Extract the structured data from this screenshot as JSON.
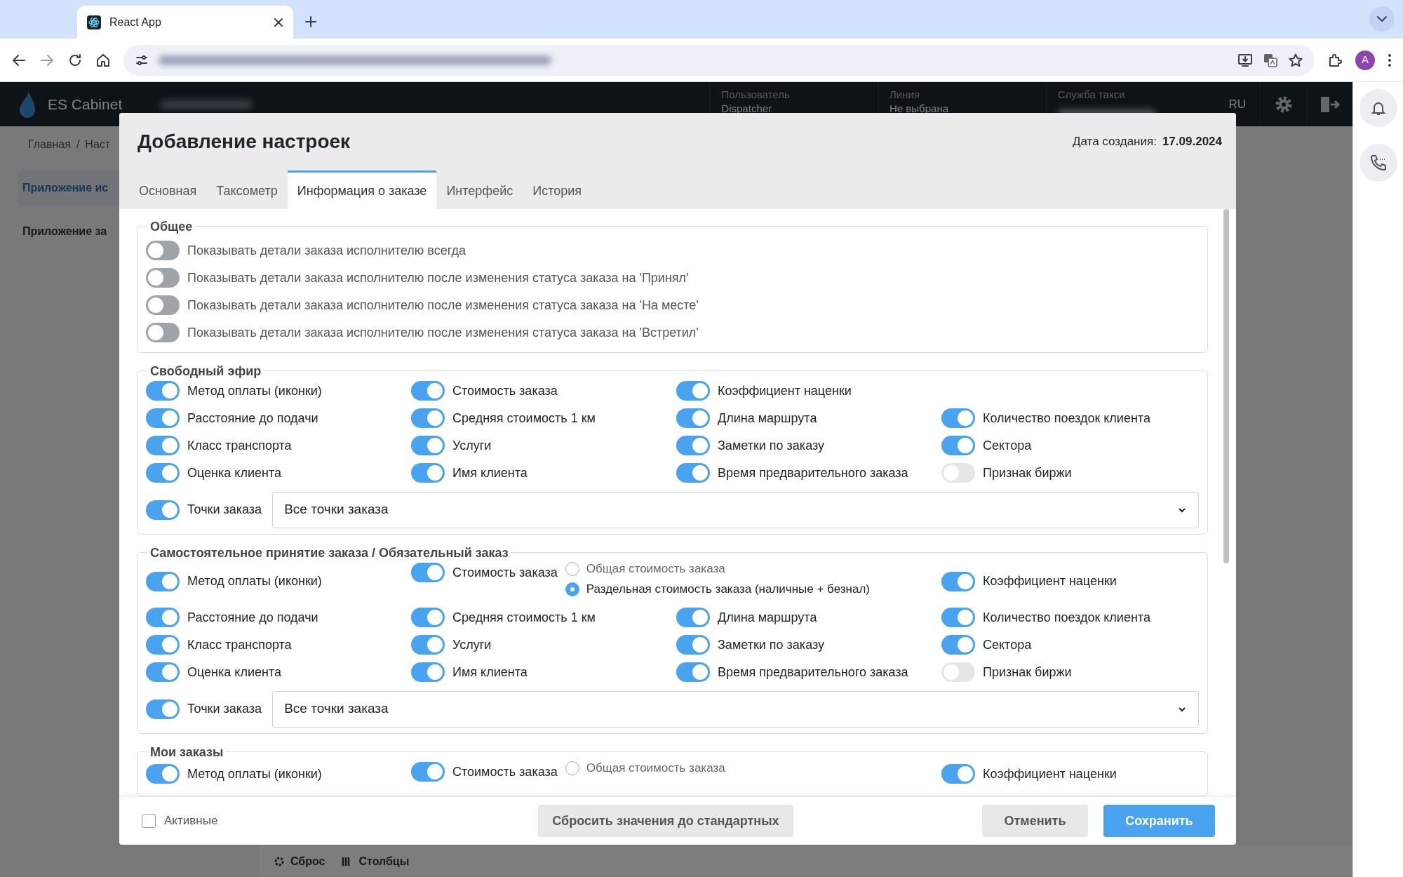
{
  "browser": {
    "tab_title": "React App",
    "avatar_letter": "A"
  },
  "app_header": {
    "brand": "ES Cabinet",
    "fields": [
      {
        "label": "Пользователь",
        "value": "Dispatcher"
      },
      {
        "label": "Линия",
        "value": "Не выбрана"
      },
      {
        "label": "Служба такси"
      }
    ],
    "language": "RU"
  },
  "page": {
    "breadcrumb": [
      "Главная",
      "Наст"
    ],
    "breadcrumb_separator": "/",
    "sidebar": [
      {
        "label": "Приложение ис",
        "selected": true
      },
      {
        "label": "Приложение за",
        "selected": false
      }
    ],
    "toolbar": [
      "Сброс",
      "Столбцы"
    ]
  },
  "modal": {
    "title": "Добавление настроек",
    "created_label": "Дата создания:",
    "created_date": "17.09.2024",
    "tabs": [
      {
        "label": "Основная",
        "selected": false
      },
      {
        "label": "Таксометр",
        "selected": false
      },
      {
        "label": "Информация о заказе",
        "selected": true
      },
      {
        "label": "Интерфейс",
        "selected": false
      },
      {
        "label": "История",
        "selected": false
      }
    ],
    "sections": [
      {
        "title": "Общее",
        "kind": "list",
        "items": [
          {
            "kind": "toggle",
            "label": "Показывать детали заказа исполнителю всегда",
            "on": false,
            "disabled": false
          },
          {
            "kind": "toggle",
            "label": "Показывать детали заказа исполнителю после изменения статуса заказа на 'Принял'",
            "on": false,
            "disabled": false
          },
          {
            "kind": "toggle",
            "label": "Показывать детали заказа исполнителю после изменения статуса заказа на 'На месте'",
            "on": false,
            "disabled": false
          },
          {
            "kind": "toggle",
            "label": "Показывать детали заказа исполнителю после изменения статуса заказа на 'Встретил'",
            "on": false,
            "disabled": false
          }
        ]
      },
      {
        "title": "Свободный эфир",
        "kind": "grid",
        "rows": [
          [
            {
              "kind": "toggle",
              "label": "Метод оплаты (иконки)",
              "on": true,
              "disabled": false
            },
            {
              "kind": "toggle",
              "label": "Стоимость заказа",
              "on": true,
              "disabled": false
            },
            {
              "kind": "toggle",
              "label": "Коэффициент наценки",
              "on": true,
              "disabled": false
            }
          ],
          [
            {
              "kind": "toggle",
              "label": "Расстояние до подачи",
              "on": true,
              "disabled": false
            },
            {
              "kind": "toggle",
              "label": "Средняя стоимость 1 км",
              "on": true,
              "disabled": false
            },
            {
              "kind": "toggle",
              "label": "Длина маршрута",
              "on": true,
              "disabled": false
            },
            {
              "kind": "toggle",
              "label": "Количество поездок клиента",
              "on": true,
              "disabled": false
            }
          ],
          [
            {
              "kind": "toggle",
              "label": "Класс транспорта",
              "on": true,
              "disabled": false
            },
            {
              "kind": "toggle",
              "label": "Услуги",
              "on": true,
              "disabled": false
            },
            {
              "kind": "toggle",
              "label": "Заметки по заказу",
              "on": true,
              "disabled": false
            },
            {
              "kind": "toggle",
              "label": "Сектора",
              "on": true,
              "disabled": false
            }
          ],
          [
            {
              "kind": "toggle",
              "label": "Оценка клиента",
              "on": true,
              "disabled": false
            },
            {
              "kind": "toggle",
              "label": "Имя клиента",
              "on": true,
              "disabled": false
            },
            {
              "kind": "toggle",
              "label": "Время предварительного заказа",
              "on": true,
              "disabled": false
            },
            {
              "kind": "toggle",
              "label": "Признак биржи",
              "on": false,
              "disabled": true
            }
          ]
        ],
        "points": {
          "label": "Точки заказа",
          "on": true,
          "value": "Все точки заказа"
        }
      },
      {
        "title": "Самостоятельное принятие заказа / Обязательный заказ",
        "kind": "grid",
        "rows": [
          [
            {
              "kind": "toggle",
              "label": "Метод оплаты (иконки)",
              "on": true,
              "disabled": false
            },
            {
              "kind": "toggle-radio",
              "label": "Стоимость заказа",
              "on": true,
              "disabled": false,
              "options": [
                {
                  "label": "Общая стоимость заказа",
                  "selected": false
                },
                {
                  "label": "Раздельная стоимость заказа (наличные + безнал)",
                  "selected": true
                }
              ]
            },
            "",
            {
              "kind": "toggle",
              "label": "Коэффициент наценки",
              "on": true,
              "disabled": false
            }
          ],
          [
            {
              "kind": "toggle",
              "label": "Расстояние до подачи",
              "on": true,
              "disabled": false
            },
            {
              "kind": "toggle",
              "label": "Средняя стоимость 1 км",
              "on": true,
              "disabled": false
            },
            {
              "kind": "toggle",
              "label": "Длина маршрута",
              "on": true,
              "disabled": false
            },
            {
              "kind": "toggle",
              "label": "Количество поездок клиента",
              "on": true,
              "disabled": false
            }
          ],
          [
            {
              "kind": "toggle",
              "label": "Класс транспорта",
              "on": true,
              "disabled": false
            },
            {
              "kind": "toggle",
              "label": "Услуги",
              "on": true,
              "disabled": false
            },
            {
              "kind": "toggle",
              "label": "Заметки по заказу",
              "on": true,
              "disabled": false
            },
            {
              "kind": "toggle",
              "label": "Сектора",
              "on": true,
              "disabled": false
            }
          ],
          [
            {
              "kind": "toggle",
              "label": "Оценка клиента",
              "on": true,
              "disabled": false
            },
            {
              "kind": "toggle",
              "label": "Имя клиента",
              "on": true,
              "disabled": false
            },
            {
              "kind": "toggle",
              "label": "Время предварительного заказа",
              "on": true,
              "disabled": false
            },
            {
              "kind": "toggle",
              "label": "Признак биржи",
              "on": false,
              "disabled": true
            }
          ]
        ],
        "points": {
          "label": "Точки заказа",
          "on": true,
          "value": "Все точки заказа"
        }
      },
      {
        "title": "Мои заказы",
        "kind": "grid",
        "rows": [
          [
            {
              "kind": "toggle",
              "label": "Метод оплаты (иконки)",
              "on": true,
              "disabled": false
            },
            {
              "kind": "toggle-radio",
              "label": "Стоимость заказа",
              "on": true,
              "disabled": false,
              "options": [
                {
                  "label": "Общая стоимость заказа",
                  "selected": false
                }
              ]
            },
            "",
            {
              "kind": "toggle",
              "label": "Коэффициент наценки",
              "on": true,
              "disabled": false
            }
          ]
        ]
      }
    ],
    "footer": {
      "active_label": "Активные",
      "active_checked": false,
      "reset": "Сбросить значения до стандартных",
      "cancel": "Отменить",
      "save": "Сохранить"
    }
  }
}
